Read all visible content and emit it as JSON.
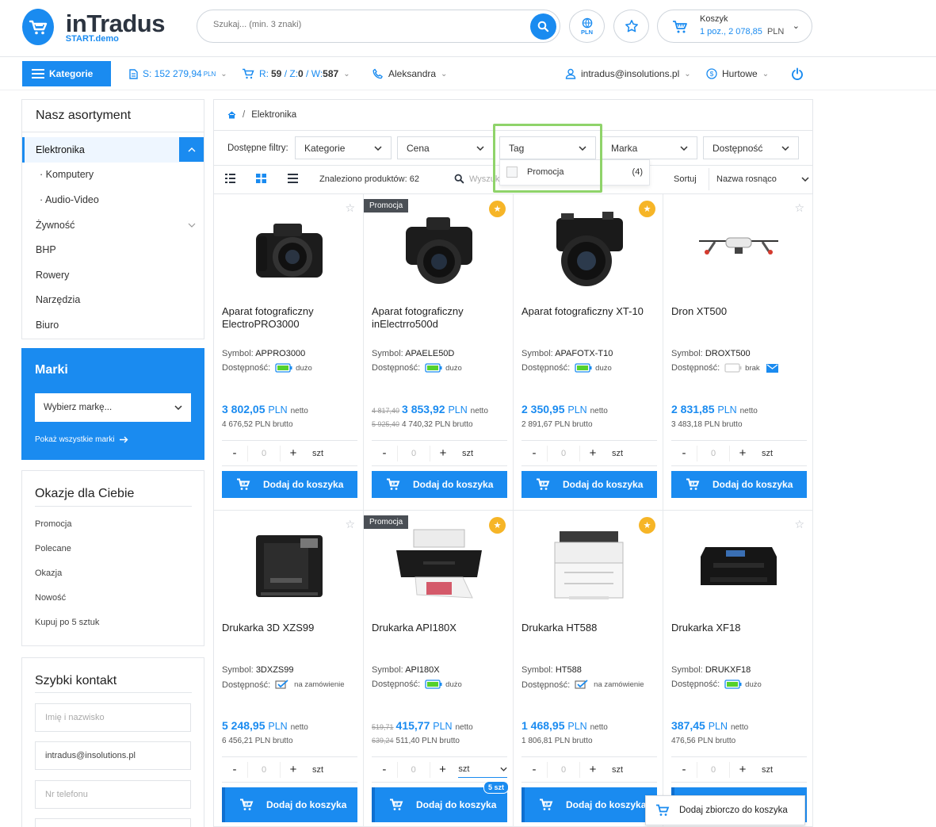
{
  "brand": {
    "name": "inTradus",
    "sub": "START.demo"
  },
  "search": {
    "placeholder": "Szukaj... (min. 3 znaki)"
  },
  "currency_btn": "PLN",
  "cart": {
    "title": "Koszyk",
    "summary": "1 poz., 2 078,85",
    "currency": "PLN"
  },
  "toolbar": {
    "categories": "Kategorie",
    "s_value": "S: 152 279,94",
    "s_currency": "PLN",
    "rzw_r": "R:",
    "rzw_r_val": "59",
    "rzw_z": " / Z:",
    "rzw_z_val": "0",
    "rzw_w": " / W:",
    "rzw_w_val": "587",
    "user": "Aleksandra",
    "email": "intradus@insolutions.pl",
    "pricing": "Hurtowe"
  },
  "sidebar": {
    "title": "Nasz asortyment",
    "items": [
      "Elektronika",
      "· Komputery",
      "· Audio-Video",
      "Żywność",
      "BHP",
      "Rowery",
      "Narzędzia",
      "Biuro"
    ]
  },
  "brands_box": {
    "title": "Marki",
    "select": "Wybierz markę...",
    "link": "Pokaż wszystkie marki"
  },
  "deals": {
    "title": "Okazje dla Ciebie",
    "items": [
      "Promocja",
      "Polecane",
      "Okazja",
      "Nowość",
      "Kupuj po 5 sztuk"
    ]
  },
  "contact": {
    "title": "Szybki kontakt",
    "name_ph": "Imię i nazwisko",
    "email_val": "intradus@insolutions.pl",
    "phone_ph": "Nr telefonu"
  },
  "breadcrumb": {
    "sep": "/",
    "current": "Elektronika"
  },
  "filters": {
    "label": "Dostępne filtry:",
    "items": [
      "Kategorie",
      "Cena",
      "Tag",
      "Marka",
      "Dostępność"
    ],
    "tag_option": "Promocja",
    "tag_count": "(4)"
  },
  "listbar": {
    "found": "Znaleziono produktów: 62",
    "search_ph": "Wyszuk",
    "sort_label": "Sortuj",
    "sort_value": "Nazwa rosnąco"
  },
  "labels": {
    "symbol": "Symbol:",
    "availability": "Dostępność:",
    "netto": "netto",
    "brutto": "PLN brutto",
    "unit": "szt",
    "add": "Dodaj do koszyka",
    "promo": "Promocja",
    "qty": "0",
    "minus": "-",
    "plus": "+",
    "bulk_add": "Dodaj zbiorczo do koszyka",
    "pack": "5 szt"
  },
  "products": [
    {
      "name": "Aparat fotograficzny ElectroPRO3000",
      "symbol": "APPRO3000",
      "avail": "dużo",
      "price": "3 802,05",
      "brutto": "4 676,52",
      "old_net": "",
      "old_brut": ""
    },
    {
      "name": "Aparat fotograficzny inElectrro500d",
      "symbol": "APAELE50D",
      "avail": "dużo",
      "price": "3 853,92",
      "brutto": "4 740,32",
      "old_net": "4 817,40",
      "old_brut": "5 925,40"
    },
    {
      "name": "Aparat fotograficzny XT-10",
      "symbol": "APAFOTX-T10",
      "avail": "dużo",
      "price": "2 350,95",
      "brutto": "2 891,67",
      "old_net": "",
      "old_brut": ""
    },
    {
      "name": "Dron XT500",
      "symbol": "DROXT500",
      "avail": "brak",
      "price": "2 831,85",
      "brutto": "3 483,18",
      "old_net": "",
      "old_brut": ""
    },
    {
      "name": "Drukarka 3D XZS99",
      "symbol": "3DXZS99",
      "avail": "na zamówienie",
      "price": "5 248,95",
      "brutto": "6 456,21",
      "old_net": "",
      "old_brut": ""
    },
    {
      "name": "Drukarka API180X",
      "symbol": "API180X",
      "avail": "dużo",
      "price": "415,77",
      "brutto": "511,40",
      "old_net": "519,71",
      "old_brut": "639,24"
    },
    {
      "name": "Drukarka HT588",
      "symbol": "HT588",
      "avail": "na zamówienie",
      "price": "1 468,95",
      "brutto": "1 806,81",
      "old_net": "",
      "old_brut": ""
    },
    {
      "name": "Drukarka XF18",
      "symbol": "DRUKXF18",
      "avail": "dużo",
      "price": "387,45",
      "brutto": "476,56",
      "old_net": "",
      "old_brut": ""
    }
  ],
  "colors": {
    "accent": "#1a8bf0",
    "promo_badge": "#4a4f55",
    "star_badge": "#f6b527",
    "filter_highlight": "#8fd36a"
  }
}
